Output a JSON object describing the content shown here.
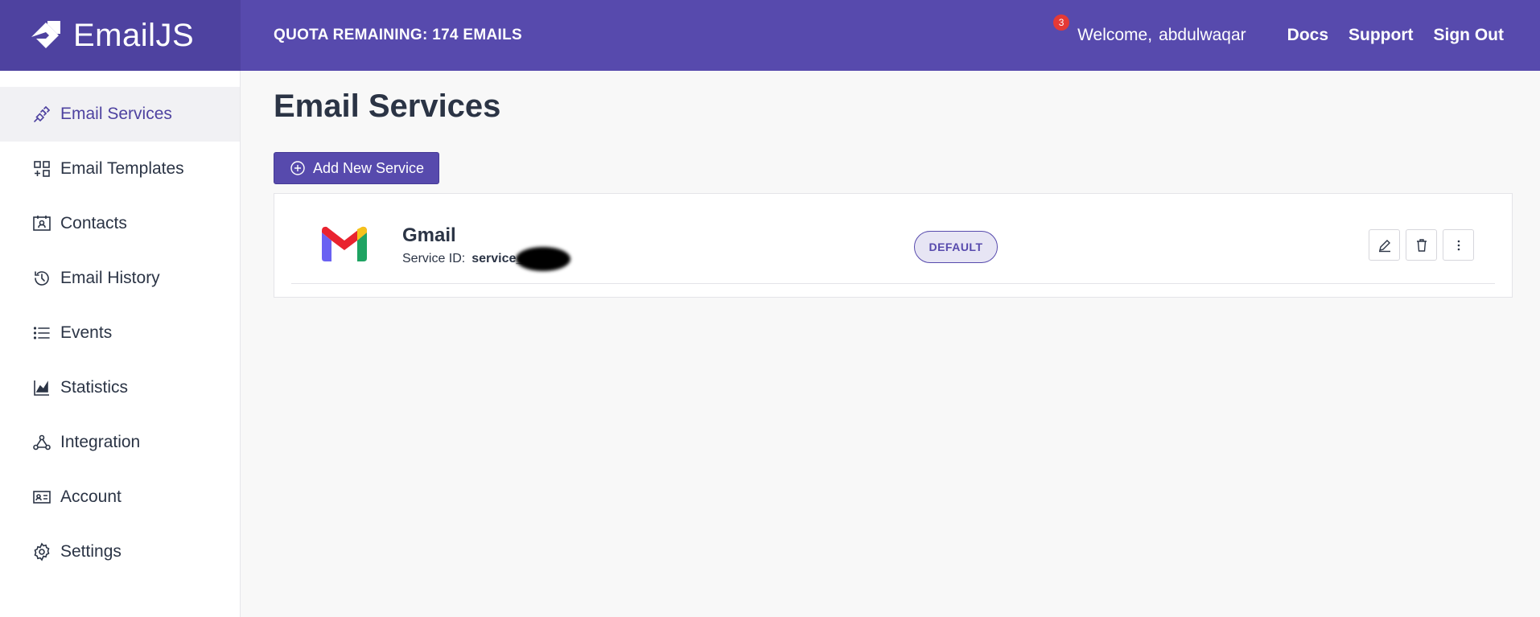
{
  "app": {
    "name": "EmailJS"
  },
  "header": {
    "quota": "QUOTA REMAINING: 174 EMAILS",
    "notification_count": "3",
    "welcome": "Welcome,",
    "username": "abdulwaqar",
    "links": [
      "Docs",
      "Support",
      "Sign Out"
    ]
  },
  "sidebar": {
    "items": [
      {
        "label": "Email Services",
        "icon": "plug-icon",
        "active": true
      },
      {
        "label": "Email Templates",
        "icon": "templates-icon"
      },
      {
        "label": "Contacts",
        "icon": "contacts-icon"
      },
      {
        "label": "Email History",
        "icon": "history-icon"
      },
      {
        "label": "Events",
        "icon": "list-icon"
      },
      {
        "label": "Statistics",
        "icon": "chart-icon"
      },
      {
        "label": "Integration",
        "icon": "integration-icon"
      },
      {
        "label": "Account",
        "icon": "id-card-icon"
      },
      {
        "label": "Settings",
        "icon": "gear-icon"
      }
    ]
  },
  "main": {
    "title": "Email Services",
    "add_button": "Add New Service",
    "services": [
      {
        "name": "Gmail",
        "id_label": "Service ID:",
        "id_value": "service_",
        "badge": "DEFAULT"
      }
    ]
  },
  "colors": {
    "brand": "#574aad",
    "brand_dark": "#4e42a0",
    "notification": "#e53935",
    "text": "#2b3445"
  }
}
